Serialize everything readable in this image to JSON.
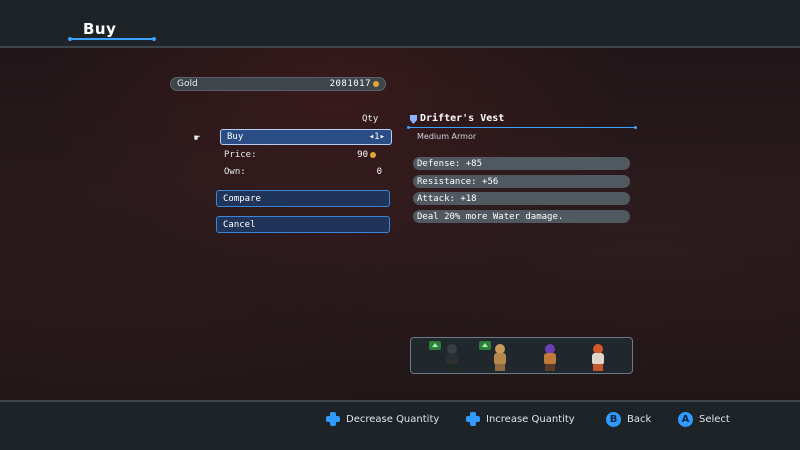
{
  "header": {
    "title": "Buy"
  },
  "gold": {
    "label": "Gold",
    "value": "2081017"
  },
  "menu": {
    "qty_header": "Qty",
    "buy_label": "Buy",
    "buy_qty": "◂1▸",
    "price_label": "Price:",
    "price_value": "90",
    "own_label": "Own:",
    "own_value": "0",
    "compare_label": "Compare",
    "cancel_label": "Cancel"
  },
  "item": {
    "name": "Drifter's Vest",
    "type": "Medium Armor",
    "stats": [
      "Defense:  +85",
      "Resistance:  +56",
      "Attack:  +18",
      "Deal 20% more Water damage."
    ]
  },
  "party": {
    "members": [
      {
        "name": "member-1",
        "colors": {
          "head": "#3a3f45",
          "body": "#2b2e33",
          "legs": "#1d2a25"
        },
        "upgrade": true
      },
      {
        "name": "member-2",
        "colors": {
          "head": "#c99a5b",
          "body": "#b7874e",
          "legs": "#8e6a3e"
        },
        "upgrade": true
      },
      {
        "name": "member-3",
        "colors": {
          "head": "#6a3fb5",
          "body": "#c07a3a",
          "legs": "#5a3b2a"
        },
        "upgrade": false
      },
      {
        "name": "member-4",
        "colors": {
          "head": "#d45a2a",
          "body": "#e0d6cc",
          "legs": "#c4572b"
        },
        "upgrade": false
      }
    ]
  },
  "footer": {
    "hints": [
      {
        "icon": "dpad-left-icon",
        "label": "Decrease Quantity"
      },
      {
        "icon": "dpad-right-icon",
        "label": "Increase Quantity"
      },
      {
        "icon": "b-button-icon",
        "glyph": "B",
        "label": "Back"
      },
      {
        "icon": "a-button-icon",
        "glyph": "A",
        "label": "Select"
      }
    ]
  },
  "colors": {
    "accent": "#3da3ff",
    "selected": "#2b4d86",
    "panel": "#1e2327"
  }
}
